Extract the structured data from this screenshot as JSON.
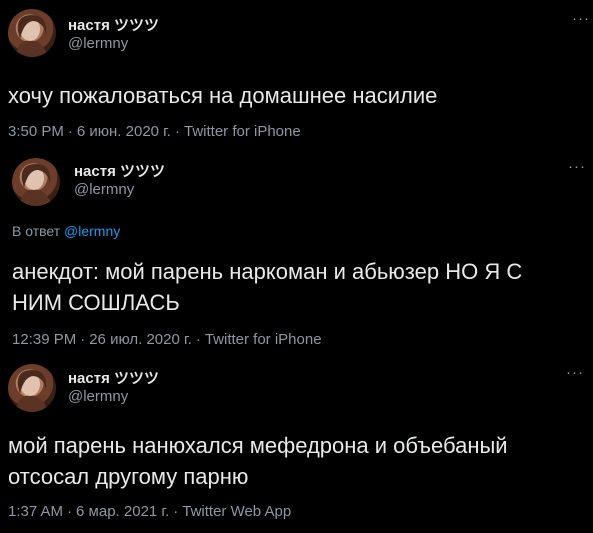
{
  "colors": {
    "background": "#000000",
    "text_primary": "#e7e9ea",
    "text_secondary": "#8b98a5",
    "link": "#1d9bf0"
  },
  "tweets": [
    {
      "name": "настя ツツツ",
      "handle": "@lermny",
      "more_icon": "more-horizontal-icon",
      "text": "хочу пожаловаться на домашнее насилие",
      "time": "3:50 PM",
      "date": "6 июн. 2020 г.",
      "source": "Twitter for iPhone",
      "separator": "·"
    },
    {
      "name": "настя ツツツ",
      "handle": "@lermny",
      "more_icon": "more-horizontal-icon",
      "reply_prefix": "В ответ",
      "reply_handle": "@lermny",
      "text": "анекдот: мой парень наркоман и абьюзер НО Я С НИМ СОШЛАСЬ",
      "time": "12:39 PM",
      "date": "26 июл. 2020 г.",
      "source": "Twitter for iPhone",
      "separator": "·"
    },
    {
      "name": "настя ツツツ",
      "handle": "@lermny",
      "more_icon": "more-horizontal-icon",
      "text": "мой парень нанюхался мефедрона и объебаный отсосал другому парню",
      "time": "1:37 AM",
      "date": "6 мар. 2021 г.",
      "source": "Twitter Web App",
      "separator": "·"
    }
  ]
}
